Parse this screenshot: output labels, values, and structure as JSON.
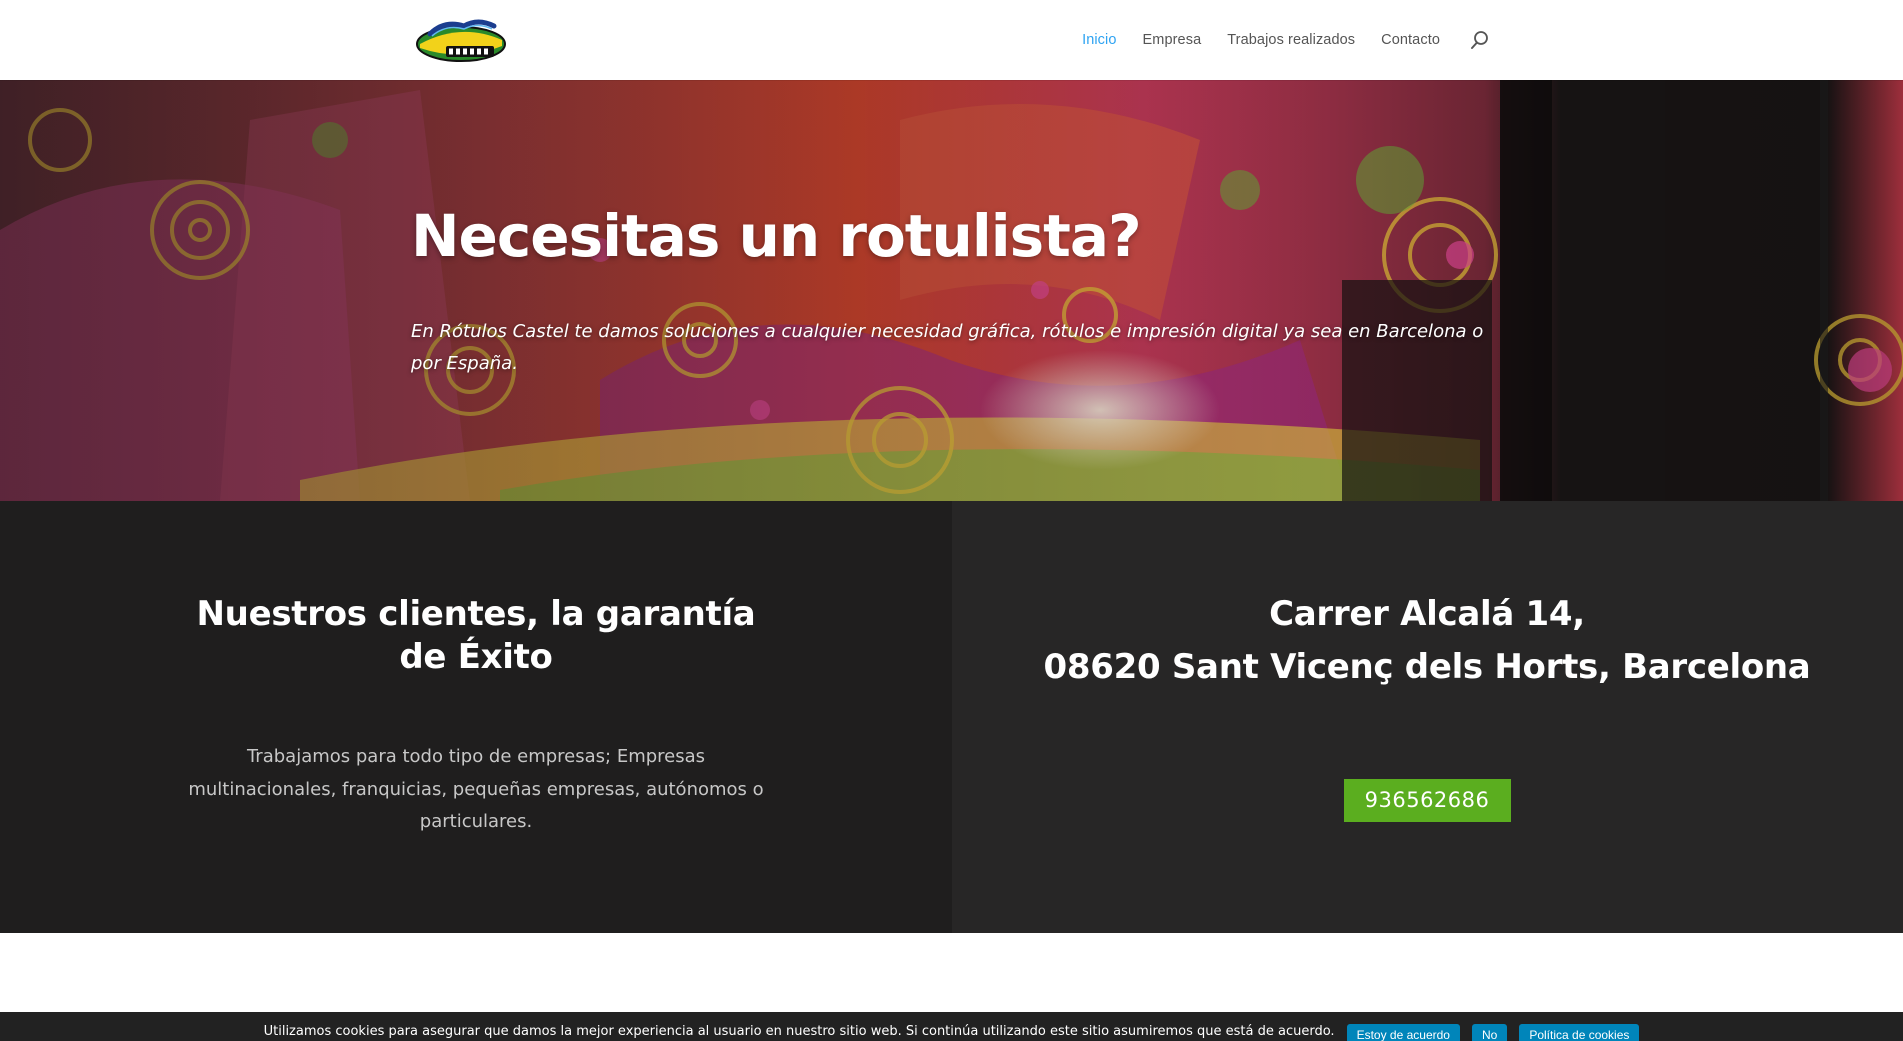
{
  "header": {
    "logo_alt": "Rótulos Castel",
    "nav": [
      {
        "label": "Inicio",
        "active": true
      },
      {
        "label": "Empresa",
        "active": false
      },
      {
        "label": "Trabajos realizados",
        "active": false
      },
      {
        "label": "Contacto",
        "active": false
      }
    ],
    "search_icon": "search-icon"
  },
  "hero": {
    "title": "Necesitas un rotulista?",
    "subtitle": "En Rótulos Castel te damos soluciones a cualquier necesidad gráfica, rótulos e impresión digital ya sea en Barcelona o por España."
  },
  "clients": {
    "heading": "Nuestros clientes, la garantía de Éxito",
    "text": "Trabajamos para todo tipo de empresas; Empresas multinacionales, franquicias, pequeñas empresas, autónomos o particulares."
  },
  "address": {
    "line1": "Carrer Alcalá 14,",
    "line2": "08620 Sant Vicenç dels Horts, Barcelona",
    "phone": "936562686"
  },
  "cookies": {
    "text": "Utilizamos cookies para asegurar que damos la mejor experiencia al usuario en nuestro sitio web. Si continúa utilizando este sitio asumiremos que está de acuerdo.",
    "accept": "Estoy de acuerdo",
    "reject": "No",
    "policy": "Política de cookies"
  },
  "colors": {
    "accent": "#2ea3f2",
    "phone_button": "#5bae1f",
    "cookie_button": "#0085ba",
    "dark_left": "#1f1e1e",
    "dark_right": "#272626"
  }
}
